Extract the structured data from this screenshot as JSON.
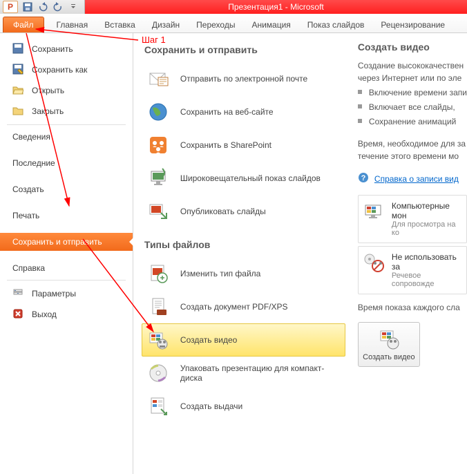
{
  "window": {
    "title": "Презентация1 - Microsoft",
    "app_letter": "P"
  },
  "ribbon": {
    "file": "Файл",
    "tabs": [
      "Главная",
      "Вставка",
      "Дизайн",
      "Переходы",
      "Анимация",
      "Показ слайдов",
      "Рецензирование"
    ]
  },
  "annotation": {
    "step1": "Шаг 1"
  },
  "sidebar": {
    "save": "Сохранить",
    "save_as": "Сохранить как",
    "open": "Открыть",
    "close": "Закрыть",
    "info": "Сведения",
    "recent": "Последние",
    "new": "Создать",
    "print": "Печать",
    "save_send": "Сохранить и отправить",
    "help": "Справка",
    "options": "Параметры",
    "exit": "Выход"
  },
  "middle": {
    "section1_title": "Сохранить и отправить",
    "section2_title": "Типы файлов",
    "items1": {
      "email": "Отправить по электронной почте",
      "web": "Сохранить на веб-сайте",
      "sharepoint": "Сохранить в SharePoint",
      "broadcast": "Широковещательный показ слайдов",
      "publish": "Опубликовать слайды"
    },
    "items2": {
      "change_type": "Изменить тип файла",
      "pdf": "Создать документ PDF/XPS",
      "video": "Создать видео",
      "package": "Упаковать презентацию для компакт-диска",
      "handouts": "Создать выдачи"
    }
  },
  "right": {
    "title": "Создать видео",
    "intro": "Создание высококачествен",
    "intro2": "через Интернет или по эле",
    "bullets": {
      "b1": "Включение времени запи",
      "b2": "Включает все слайды,",
      "b3": "Сохранение анимаций"
    },
    "timing1": "Время, необходимое для за",
    "timing2": "течение этого времени мо",
    "help_link": "Справка о записи вид",
    "opt1_title": "Компьютерные мон",
    "opt1_sub": "Для просмотра на ко",
    "opt2_title": "Не использовать за",
    "opt2_sub": "Речевое сопровожде",
    "duration_label": "Время показа каждого сла",
    "create_btn": "Создать видео"
  }
}
